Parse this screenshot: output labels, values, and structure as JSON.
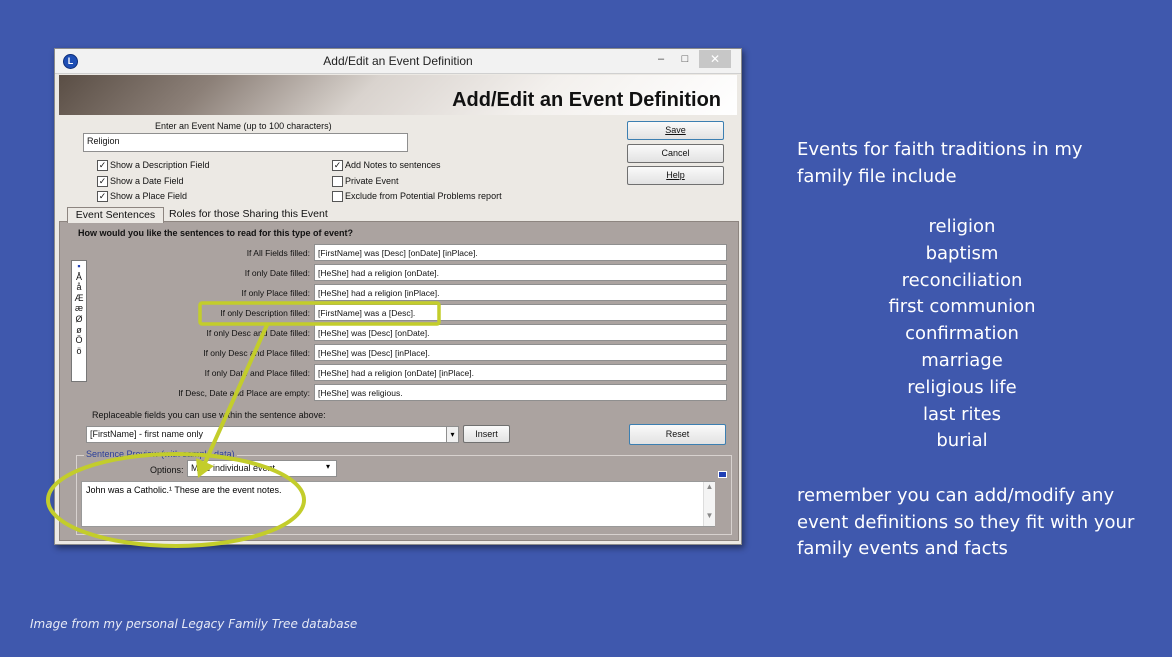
{
  "window": {
    "title": "Add/Edit an Event Definition",
    "banner_title": "Add/Edit an Event Definition",
    "minimize": "–",
    "maximize": "□",
    "close": "✕"
  },
  "event_name": {
    "label": "Enter an Event Name (up to 100 characters)",
    "value": "Religion"
  },
  "buttons": {
    "save": "Save",
    "cancel": "Cancel",
    "help": "Help",
    "insert": "Insert",
    "reset": "Reset"
  },
  "checkboxes": {
    "show_description": {
      "label": "Show a Description Field",
      "checked": true
    },
    "show_date": {
      "label": "Show a Date Field",
      "checked": true
    },
    "show_place": {
      "label": "Show a Place Field",
      "checked": true
    },
    "add_notes": {
      "label": "Add Notes to sentences",
      "checked": true
    },
    "private_event": {
      "label": "Private Event",
      "checked": false
    },
    "exclude_problems": {
      "label": "Exclude from Potential Problems report",
      "checked": false
    }
  },
  "tabs": {
    "event_sentences": "Event Sentences",
    "roles": "Roles for those Sharing this Event"
  },
  "sentences": {
    "heading": "How would you like the sentences to read for this type of event?",
    "rows": [
      {
        "label": "If All Fields filled:",
        "value": "[FirstName] was [Desc] [onDate] [inPlace]."
      },
      {
        "label": "If only Date filled:",
        "value": "[HeShe] had a religion [onDate]."
      },
      {
        "label": "If only Place filled:",
        "value": "[HeShe] had a religion [inPlace]."
      },
      {
        "label": "If only Description filled:",
        "value": "[FirstName] was a [Desc]."
      },
      {
        "label": "If only Desc and Date filled:",
        "value": "[HeShe] was [Desc] [onDate]."
      },
      {
        "label": "If only Desc and Place filled:",
        "value": "[HeShe] was [Desc] [inPlace]."
      },
      {
        "label": "If only Date and Place filled:",
        "value": "[HeShe] had a religion [onDate] [inPlace]."
      },
      {
        "label": "If Desc, Date and Place are empty:",
        "value": "[HeShe] was religious."
      }
    ],
    "special_chars": [
      "▪",
      "Å",
      "å",
      "Æ",
      "æ",
      "Ø",
      "ø",
      "Ö",
      "ö"
    ]
  },
  "replaceable": {
    "label": "Replaceable fields you can use within the sentence above:",
    "selected": "[FirstName] - first name only"
  },
  "preview": {
    "legend": "Sentence Preview (with sample data)",
    "options_label": "Options:",
    "options_selected": "Male individual event",
    "text": "John was a Catholic.¹ These are the event notes."
  },
  "slide": {
    "heading": "Events for faith traditions in my family file include",
    "events": [
      "religion",
      "baptism",
      "reconciliation",
      "first communion",
      "confirmation",
      "marriage",
      "religious life",
      "last rites",
      "burial"
    ],
    "remember": "remember you can add/modify any event definitions so they fit with your family events and facts",
    "credit": "Image from my personal Legacy Family Tree database"
  },
  "colors": {
    "background": "#3f58ad",
    "highlight": "#c3cd2b",
    "panel": "#aba3a0"
  }
}
